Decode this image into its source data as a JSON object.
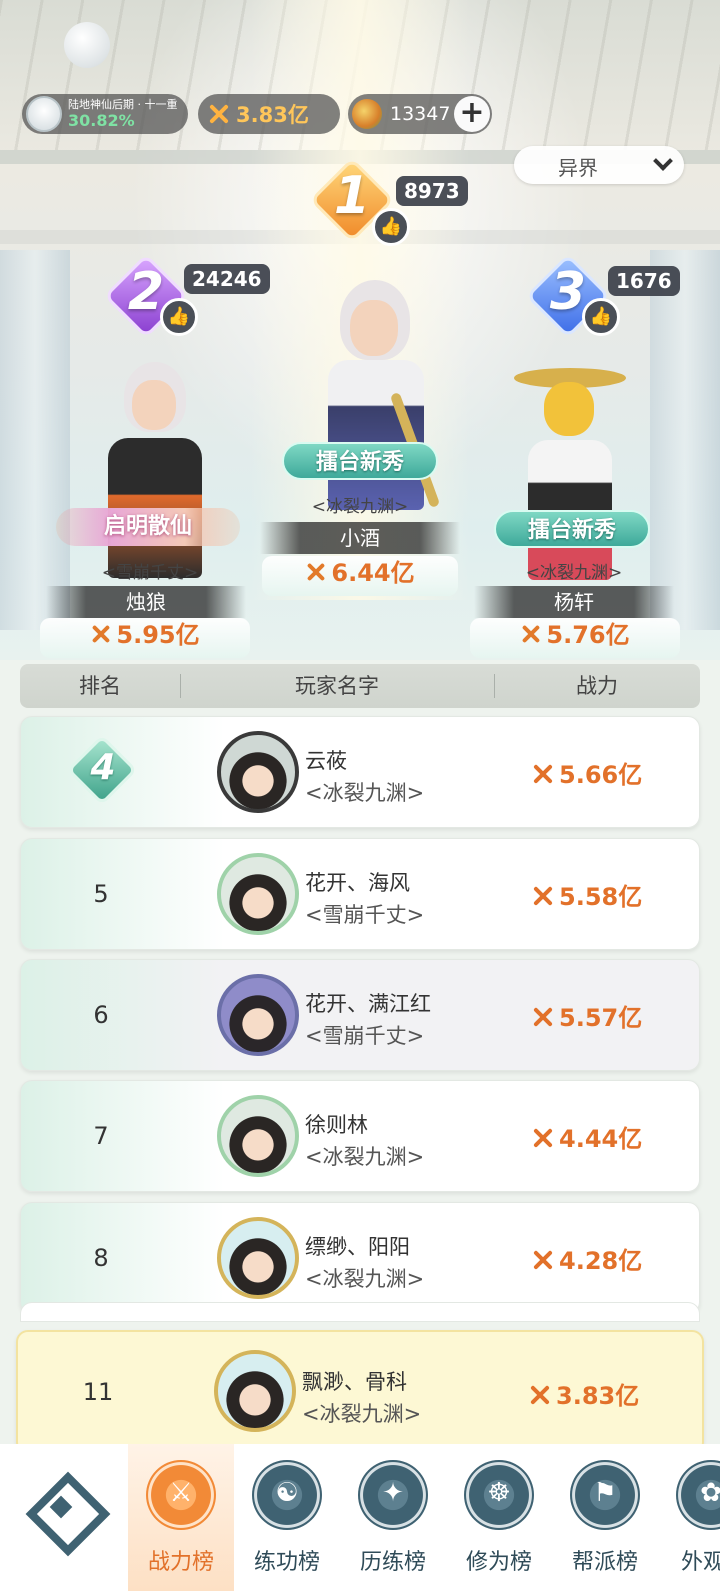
{
  "status_bar": {
    "realm_text": "陆地神仙后期 · 十一重",
    "realm_progress": "30.82%",
    "power": "3.83亿",
    "currency": "13347",
    "plus_icon": "plus-icon",
    "power_icon": "crossed-swords-icon",
    "currency_icon": "spirit-coin-icon"
  },
  "server_select": {
    "value": "异界"
  },
  "podium": [
    {
      "rank": "1",
      "likes": "8973",
      "title": "擂台新秀",
      "guild": "<冰裂九渊>",
      "name": "小酒",
      "power": "6.44亿"
    },
    {
      "rank": "2",
      "likes": "24246",
      "title": "启明散仙",
      "guild": "<雪崩千丈>",
      "name": "烛狼",
      "power": "5.95亿"
    },
    {
      "rank": "3",
      "likes": "1676",
      "title": "擂台新秀",
      "guild": "<冰裂九渊>",
      "name": "杨轩",
      "power": "5.76亿"
    }
  ],
  "table": {
    "headers": [
      "排名",
      "玩家名字",
      "战力"
    ],
    "rows": [
      {
        "rank": "4",
        "name": "云莜",
        "guild": "<冰裂九渊>",
        "power": "5.66亿"
      },
      {
        "rank": "5",
        "name": "花开、海风",
        "guild": "<雪崩千丈>",
        "power": "5.58亿"
      },
      {
        "rank": "6",
        "name": "花开、满江红",
        "guild": "<雪崩千丈>",
        "power": "5.57亿"
      },
      {
        "rank": "7",
        "name": "徐则林",
        "guild": "<冰裂九渊>",
        "power": "4.44亿"
      },
      {
        "rank": "8",
        "name": "缥缈、阳阳",
        "guild": "<冰裂九渊>",
        "power": "4.28亿"
      }
    ],
    "self_row": {
      "rank": "11",
      "name": "飘渺、骨科",
      "guild": "<冰裂九渊>",
      "power": "3.83亿"
    }
  },
  "bottom_nav": [
    {
      "label": "战力榜",
      "active": true
    },
    {
      "label": "练功榜",
      "active": false
    },
    {
      "label": "历练榜",
      "active": false
    },
    {
      "label": "修为榜",
      "active": false
    },
    {
      "label": "帮派榜",
      "active": false
    },
    {
      "label": "外观",
      "active": false
    }
  ],
  "colors": {
    "accent_orange": "#e2712a",
    "jade": "#3ea99a",
    "rank1": "#f6a23a",
    "rank2": "#a35ad6",
    "rank3": "#4f7df0"
  }
}
